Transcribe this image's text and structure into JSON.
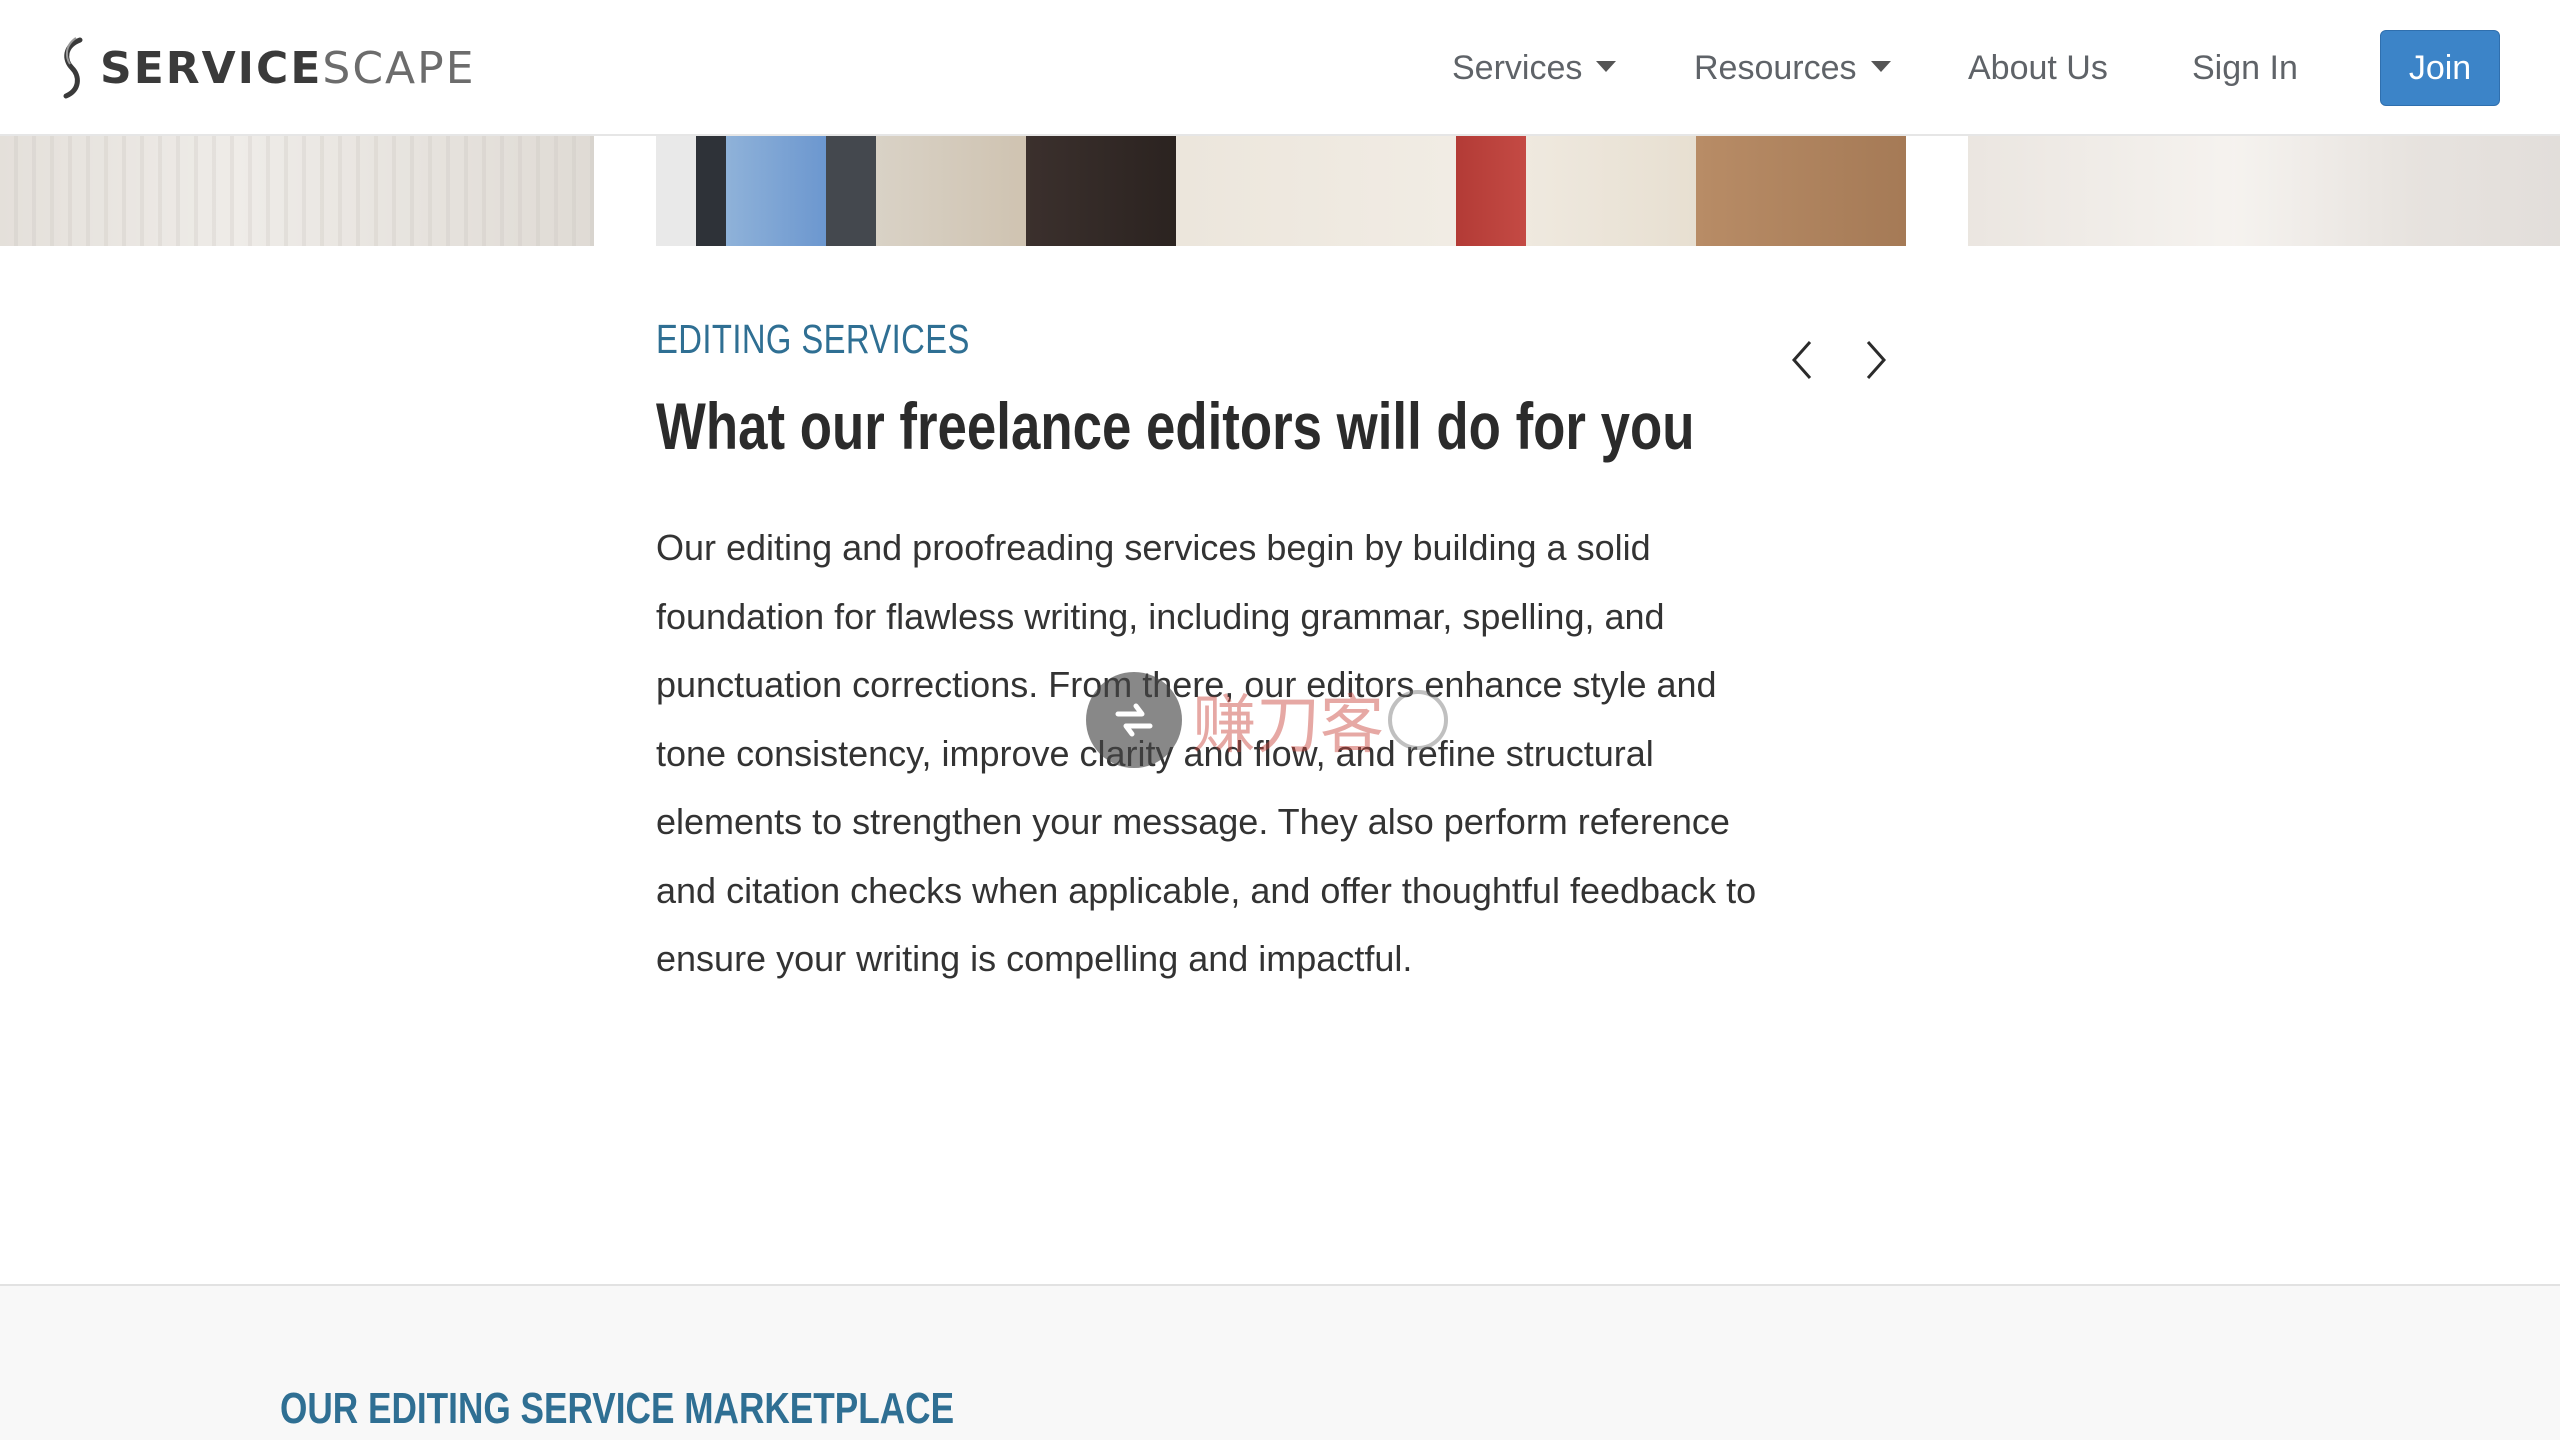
{
  "header": {
    "logo": {
      "text_strong": "SERVICE",
      "text_light": "SCAPE",
      "icon": "s-logo-icon"
    },
    "nav": {
      "services": "Services",
      "resources": "Resources",
      "about": "About Us",
      "sign_in": "Sign In",
      "join": "Join"
    },
    "dropdown_icon": "caret-down-icon"
  },
  "main": {
    "kicker": "EDITING SERVICES",
    "heading": "What our freelance editors will do for you",
    "description": "Our editing and proofreading services begin by building a solid foundation for flawless writing, including grammar, spelling, and punctuation corrections. From there, our editors enhance style and tone consistency, improve clarity and flow, and refine structural elements to strengthen your message. They also perform reference and citation checks when applicable, and offer thoughtful feedback to ensure your writing is compelling and impactful.",
    "prev_icon": "chevron-left-icon",
    "next_icon": "chevron-right-icon"
  },
  "watermark": {
    "text": "赚刀客"
  },
  "marketplace": {
    "title": "OUR EDITING SERVICE MARKETPLACE"
  },
  "colors": {
    "accent": "#2f6f93",
    "join_button": "#3c84c8",
    "band_background": "#f8f8f8"
  }
}
